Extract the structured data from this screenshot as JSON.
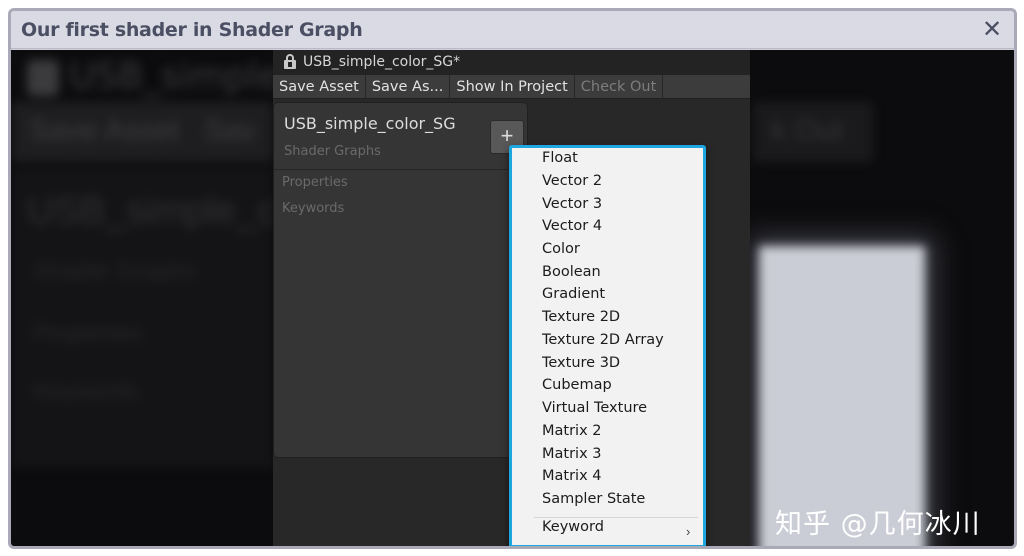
{
  "dialog": {
    "title": "Our first shader in Shader Graph",
    "close_glyph": "✕"
  },
  "editor": {
    "window_title": "USB_simple_color_SG*",
    "toolbar": {
      "save_asset": "Save Asset",
      "save_as": "Save As...",
      "show_in_project": "Show In Project",
      "check_out": "Check Out"
    },
    "blackboard": {
      "title": "USB_simple_color_SG",
      "subtitle": "Shader Graphs",
      "properties": "Properties",
      "keywords": "Keywords",
      "add_glyph": "+"
    }
  },
  "context_menu": {
    "items": [
      "Float",
      "Vector 2",
      "Vector 3",
      "Vector 4",
      "Color",
      "Boolean",
      "Gradient",
      "Texture 2D",
      "Texture 2D Array",
      "Texture 3D",
      "Cubemap",
      "Virtual Texture",
      "Matrix 2",
      "Matrix 3",
      "Matrix 4",
      "Sampler State"
    ],
    "submenu_item": "Keyword",
    "submenu_arrow": "›"
  },
  "watermark": "知乎 @几何冰川",
  "colors": {
    "menu_border": "#1ea6e0",
    "dialog_title": "#4b4f63",
    "editor_bg": "#282828"
  }
}
